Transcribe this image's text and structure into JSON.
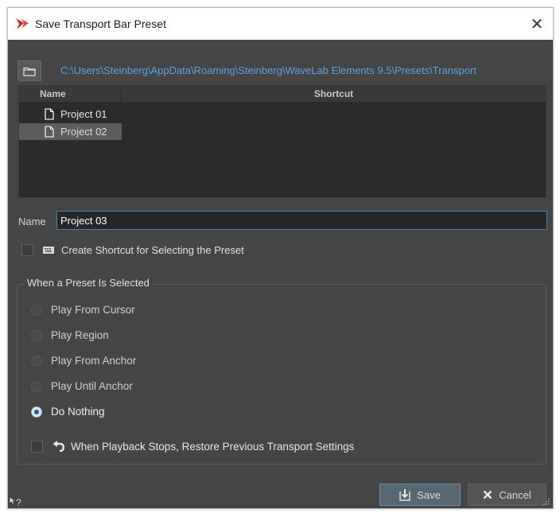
{
  "window": {
    "title": "Save Transport Bar Preset",
    "close_symbol": "✕"
  },
  "path": {
    "folder_icon": "folder-icon",
    "value": "C:\\Users\\Steinberg\\AppData\\Roaming\\Steinberg\\WaveLab Elements 9.5\\Presets\\Transport"
  },
  "table": {
    "columns": [
      "Name",
      "Shortcut"
    ],
    "rows": [
      {
        "name": "Project 01",
        "shortcut": "",
        "selected": false
      },
      {
        "name": "Project 02",
        "shortcut": "",
        "selected": true
      }
    ]
  },
  "name_field": {
    "label": "Name",
    "value": "Project 03"
  },
  "create_shortcut": {
    "label": "Create Shortcut for Selecting the Preset",
    "checked": false,
    "icon": "keyboard-icon"
  },
  "preset_group": {
    "title": "When a Preset Is Selected",
    "options": [
      {
        "label": "Play From Cursor",
        "checked": false
      },
      {
        "label": "Play Region",
        "checked": false
      },
      {
        "label": "Play From Anchor",
        "checked": false
      },
      {
        "label": "Play Until Anchor",
        "checked": false
      },
      {
        "label": "Do Nothing",
        "checked": true
      }
    ],
    "restore": {
      "label": "When Playback Stops, Restore Previous Transport Settings",
      "checked": false,
      "icon": "undo-icon"
    }
  },
  "buttons": {
    "save": "Save",
    "cancel": "Cancel"
  },
  "help_symbol": "?",
  "colors": {
    "path_link": "#5aa0dc",
    "panel_bg": "#454545",
    "radio_selected": "#2a5d8f"
  }
}
